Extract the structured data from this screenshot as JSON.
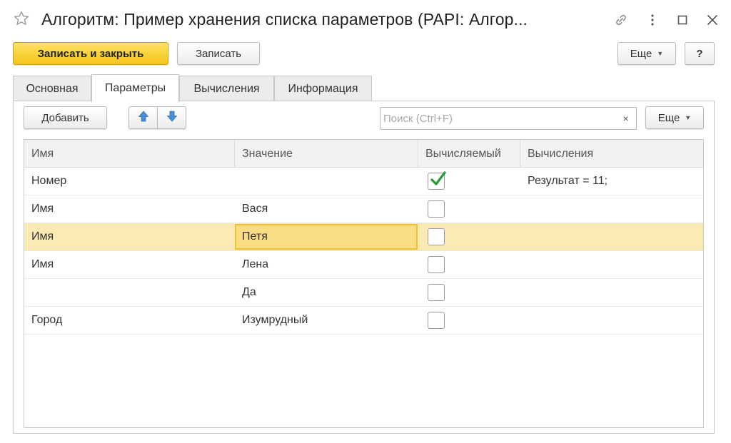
{
  "window": {
    "title": "Алгоритм: Пример хранения списка параметров (PAPI: Алгор..."
  },
  "toolbar": {
    "save_close_label": "Записать и закрыть",
    "save_label": "Записать",
    "more_label": "Еще",
    "help_label": "?"
  },
  "tabs": [
    {
      "label": "Основная"
    },
    {
      "label": "Параметры"
    },
    {
      "label": "Вычисления"
    },
    {
      "label": "Информация"
    }
  ],
  "active_tab": "Параметры",
  "params_toolbar": {
    "add_label": "Добавить",
    "search_placeholder": "Поиск (Ctrl+F)",
    "clear_label": "×",
    "more_label": "Еще"
  },
  "table": {
    "columns": [
      "Имя",
      "Значение",
      "Вычисляемый",
      "Вычисления"
    ],
    "rows": [
      {
        "name": "Номер",
        "value": "",
        "computed": true,
        "calc": "Результат = 11;"
      },
      {
        "name": "Имя",
        "value": "Вася",
        "computed": false,
        "calc": ""
      },
      {
        "name": "Имя",
        "value": "Петя",
        "computed": false,
        "calc": "",
        "selected": true
      },
      {
        "name": "Имя",
        "value": "Лена",
        "computed": false,
        "calc": ""
      },
      {
        "name": "",
        "value": "Да",
        "computed": false,
        "calc": ""
      },
      {
        "name": "Город",
        "value": "Изумрудный",
        "computed": false,
        "calc": ""
      }
    ]
  },
  "colors": {
    "primary_button": "#f5c518",
    "selected_row": "#fbeab3",
    "editing_cell": "#f9dd84",
    "checkmark": "#1f9a3a",
    "arrow_icon": "#4a8fd6"
  },
  "icons": [
    "star-icon",
    "link-icon",
    "kebab-menu-icon",
    "maximize-icon",
    "close-icon",
    "arrow-up-icon",
    "arrow-down-icon",
    "checkmark-icon"
  ]
}
